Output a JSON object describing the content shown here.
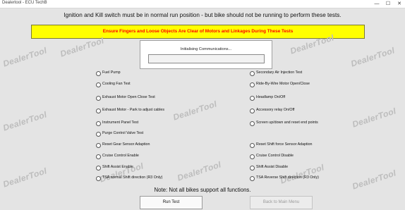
{
  "window": {
    "title": "Dealertool - ECU TechB",
    "minimize_glyph": "—",
    "maximize_glyph": "☐",
    "close_glyph": "✕"
  },
  "headline": "Ignition and Kill switch must be in normal run position -  but bike should not be running to perform these tests.",
  "warning": "Ensure Fingers and Loose Objects Are Clear of Motors and Linkages During These Tests",
  "status": {
    "text": "Initialising Communications...",
    "progress": 0
  },
  "watermark": "DealerTool",
  "options_left": [
    "Fuel Pump",
    "Cooling Fan Test",
    "Exhaust Motor Open Close Test",
    "Exhaust Motor - Park to adjust cables",
    "Instrument Panel Test",
    "Purge Control Valve Test",
    "Reset Gear Sensor Adaption",
    "Cruise Control Enable",
    "Shift Assist Enable",
    "TSA normal Shift direction (R3 Only)"
  ],
  "options_right": [
    "Secondary Air Injection Test",
    "Ride-By-Wire Motor Open/Close",
    "Headlamp On/Off",
    "Accessory relay On/Off",
    "Screen up/down and reset end points",
    "",
    "Reset Shift force Sensor Adaption",
    "Cruise Control Disable",
    "Shift Assist Disable",
    "TSA Reverse Shift direction (R3 Only)"
  ],
  "note": "Note: Not all bikes support all functions.",
  "buttons": {
    "run": "Run Test",
    "back": "Back to Main Menu"
  },
  "colors": {
    "warning_bg": "#ffff00",
    "warning_text": "#ff0000",
    "window_bg": "#e4e4e4"
  }
}
